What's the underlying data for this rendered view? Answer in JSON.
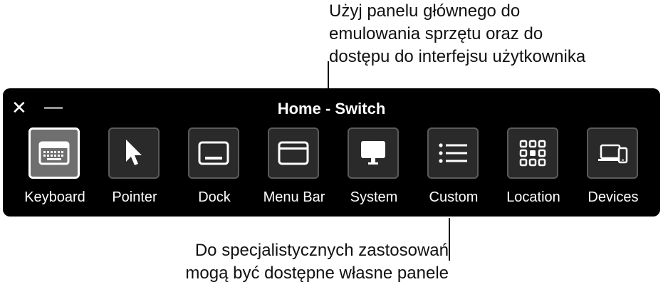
{
  "callouts": {
    "top_lines": [
      "Użyj panelu głównego do",
      "emulowania sprzętu oraz do",
      "dostępu do interfejsu użytkownika"
    ],
    "bottom_lines": [
      "Do specjalistycznych zastosowań",
      "mogą być dostępne własne panele"
    ]
  },
  "panel": {
    "title": "Home - Switch",
    "close_glyph": "✕",
    "minimize_glyph": "—",
    "items": [
      {
        "label": "Keyboard",
        "icon": "keyboard-icon",
        "selected": true
      },
      {
        "label": "Pointer",
        "icon": "pointer-icon",
        "selected": false
      },
      {
        "label": "Dock",
        "icon": "dock-icon",
        "selected": false
      },
      {
        "label": "Menu Bar",
        "icon": "menu-bar-icon",
        "selected": false
      },
      {
        "label": "System",
        "icon": "monitor-icon",
        "selected": false
      },
      {
        "label": "Custom",
        "icon": "list-icon",
        "selected": false
      },
      {
        "label": "Location",
        "icon": "grid-icon",
        "selected": false
      },
      {
        "label": "Devices",
        "icon": "devices-icon",
        "selected": false
      }
    ]
  }
}
